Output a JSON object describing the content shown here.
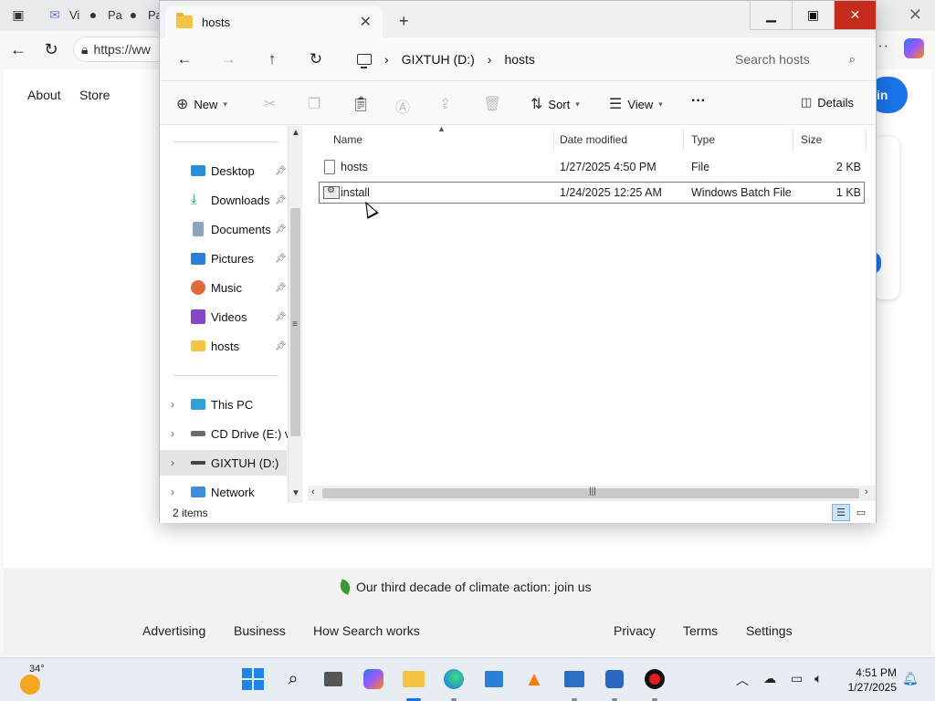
{
  "browser": {
    "tab1_text": "Vi",
    "tab2_text": "Pa",
    "tab3_text": "Pa",
    "url_text": "https://ww",
    "nav": [
      "About",
      "Store"
    ],
    "signin_label": "in",
    "climate_text": "Our third decade of climate action: join us",
    "footer_left": [
      "Advertising",
      "Business",
      "How Search works"
    ],
    "footer_right": [
      "Privacy",
      "Terms",
      "Settings"
    ]
  },
  "explorer": {
    "tab_title": "hosts",
    "breadcrumb": [
      "GIXTUH (D:)",
      "hosts"
    ],
    "search_placeholder": "Search hosts",
    "commands": {
      "new": "New",
      "sort": "Sort",
      "view": "View",
      "more": "···",
      "details": "Details"
    },
    "nav_pane": [
      {
        "label": "Desktop",
        "icon": "desktop-icon",
        "pinned": true
      },
      {
        "label": "Downloads",
        "icon": "downloads-icon",
        "pinned": true
      },
      {
        "label": "Documents",
        "icon": "documents-icon",
        "pinned": true
      },
      {
        "label": "Pictures",
        "icon": "pictures-icon",
        "pinned": true
      },
      {
        "label": "Music",
        "icon": "music-icon",
        "pinned": true
      },
      {
        "label": "Videos",
        "icon": "videos-icon",
        "pinned": true
      },
      {
        "label": "hosts",
        "icon": "folder-icon",
        "pinned": true
      }
    ],
    "nav_tree": [
      {
        "label": "This PC",
        "icon": "this-pc-icon"
      },
      {
        "label": "CD Drive (E:) virt",
        "icon": "cd-drive-icon"
      },
      {
        "label": "GIXTUH (D:)",
        "icon": "drive-icon",
        "selected": true
      },
      {
        "label": "Network",
        "icon": "network-icon"
      }
    ],
    "columns": [
      "Name",
      "Date modified",
      "Type",
      "Size"
    ],
    "files": [
      {
        "name": "hosts",
        "date": "1/27/2025 4:50 PM",
        "type": "File",
        "size": "2 KB",
        "icon": "file-icon"
      },
      {
        "name": "install",
        "date": "1/24/2025 12:25 AM",
        "type": "Windows Batch File",
        "size": "1 KB",
        "icon": "batch-file-icon"
      }
    ],
    "status_count": "2 items"
  },
  "taskbar": {
    "temperature": "34°",
    "time": "4:51 PM",
    "date": "1/27/2025"
  },
  "colors": {
    "accent": "#1a73e8",
    "close_red": "#c42b1c",
    "folder_yellow": "#f4c542"
  }
}
